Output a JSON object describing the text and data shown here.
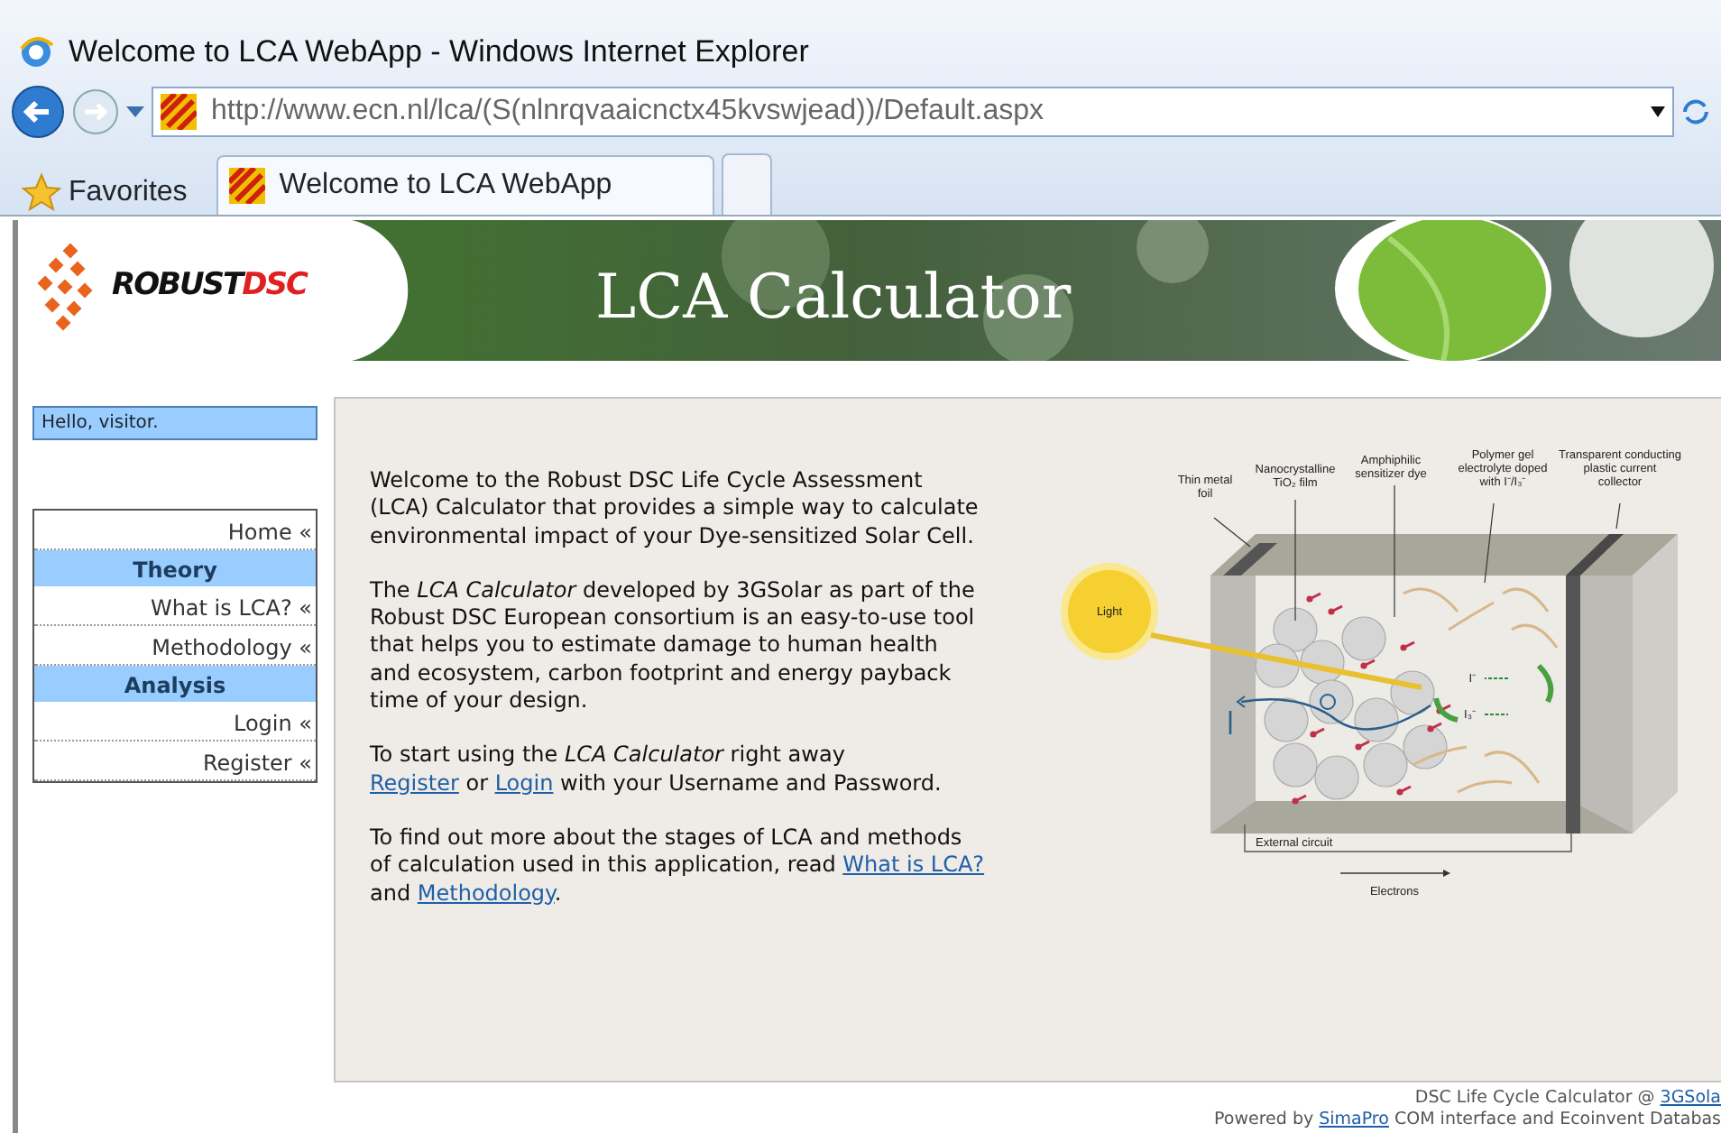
{
  "window": {
    "title": "Welcome to LCA WebApp - Windows Internet Explorer"
  },
  "address_bar": {
    "url": "http://www.ecn.nl/lca/(S(nlnrqvaaicnctx45kvswjead))/Default.aspx"
  },
  "favorites": {
    "label": "Favorites"
  },
  "tabs": [
    {
      "label": "Welcome to LCA WebApp",
      "selected": true
    }
  ],
  "header": {
    "logo": [
      "ROBUST",
      "DSC"
    ],
    "title": "LCA Calculator"
  },
  "greeting": "Hello, visitor.",
  "menu": [
    {
      "kind": "link",
      "label": "Home «"
    },
    {
      "kind": "heading",
      "label": "Theory"
    },
    {
      "kind": "link",
      "label": "What is LCA? «"
    },
    {
      "kind": "link",
      "label": "Methodology «"
    },
    {
      "kind": "heading",
      "label": "Analysis"
    },
    {
      "kind": "link",
      "label": "Login «"
    },
    {
      "kind": "link",
      "label": "Register «"
    }
  ],
  "content": {
    "paragraphs": [
      [
        {
          "kind": "text",
          "text": "Welcome to the Robust DSC Life Cycle Assessment (LCA) Calculator that provides a simple way to calculate environmental impact of your Dye-sensitized Solar Cell."
        }
      ],
      [
        {
          "kind": "text",
          "text": "The *LCA Calculator* developed by 3GSolar as part of the Robust DSC European consortium is an easy-to-use tool that helps you to estimate damage to human health and ecosystem, carbon footprint and energy payback time of your design."
        }
      ],
      [
        {
          "kind": "text",
          "text": "To start using the *LCA Calculator* right away"
        },
        {
          "kind": "break"
        },
        {
          "kind": "link",
          "text": "Register"
        },
        {
          "kind": "text",
          "text": " or "
        },
        {
          "kind": "link",
          "text": "Login"
        },
        {
          "kind": "text",
          "text": " with your Username and Password."
        }
      ],
      [
        {
          "kind": "text",
          "text": "To find out more about the stages of LCA and methods of calculation used in this application, read "
        },
        {
          "kind": "link",
          "text": "What is LCA?"
        },
        {
          "kind": "text",
          "text": " and "
        },
        {
          "kind": "link",
          "text": "Methodology"
        },
        {
          "kind": "text",
          "text": "."
        }
      ]
    ]
  },
  "diagram": {
    "labels": [
      {
        "lines": [
          "Thin metal",
          "foil"
        ]
      },
      {
        "lines": [
          "Nanocrystalline",
          "TiO₂ film"
        ]
      },
      {
        "lines": [
          "Amphiphilic",
          "sensitizer dye"
        ]
      },
      {
        "lines": [
          "Polymer gel",
          "electrolyte doped",
          "with I⁻/I₃⁻"
        ]
      },
      {
        "lines": [
          "Transparent conducting",
          "plastic current",
          "collector"
        ]
      },
      {
        "lines": [
          "Light"
        ]
      },
      {
        "lines": [
          "I⁻"
        ]
      },
      {
        "lines": [
          "I₃⁻"
        ]
      },
      {
        "lines": [
          "External circuit"
        ]
      },
      {
        "lines": [
          "Electrons"
        ]
      }
    ]
  },
  "footer": {
    "lines": [
      [
        {
          "kind": "text",
          "text": "DSC Life Cycle Calculator @ "
        },
        {
          "kind": "link",
          "text": "3GSola"
        }
      ],
      [
        {
          "kind": "text",
          "text": "Powered by "
        },
        {
          "kind": "link",
          "text": "SimaPro"
        },
        {
          "kind": "text",
          "text": " COM interface and Ecoinvent Databas"
        }
      ]
    ]
  }
}
